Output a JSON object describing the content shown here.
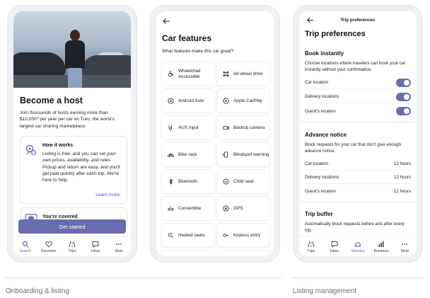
{
  "colors": {
    "accent": "#6b6bb0",
    "link": "#593cfb"
  },
  "onboarding": {
    "title": "Become a host",
    "description": "Join thousands of hosts earning more than $10,000* per year per car on Turo, the world's largest car sharing marketplace.",
    "how_it_works": {
      "icon": "gears-icon",
      "title": "How it works",
      "description": "Listing is free, and you can set your own prices, availability, and rules. Pickup and return are easy, and you'll get paid quickly after each trip. We're here to help.",
      "link": "Learn more"
    },
    "covered": {
      "icon": "shield-card-icon",
      "title": "You're covered"
    },
    "cta": "Get started",
    "tabs": [
      {
        "label": "Search",
        "icon": "search-icon",
        "active": true
      },
      {
        "label": "Favorites",
        "icon": "heart-icon",
        "active": false
      },
      {
        "label": "Trips",
        "icon": "road-icon",
        "active": false
      },
      {
        "label": "Inbox",
        "icon": "chat-icon",
        "active": false
      },
      {
        "label": "More",
        "icon": "more-icon",
        "active": false
      }
    ]
  },
  "car_features": {
    "title": "Car features",
    "subtitle": "What features make this car great?",
    "features": [
      {
        "label": "Wheelchair Accessible",
        "icon": "wheelchair-icon"
      },
      {
        "label": "All-wheel drive",
        "icon": "awd-icon"
      },
      {
        "label": "Android Auto",
        "icon": "android-auto-icon"
      },
      {
        "label": "Apple CarPlay",
        "icon": "carplay-icon"
      },
      {
        "label": "AUX input",
        "icon": "aux-icon"
      },
      {
        "label": "Backup camera",
        "icon": "camera-icon"
      },
      {
        "label": "Bike rack",
        "icon": "bike-icon"
      },
      {
        "label": "Blindspot warning",
        "icon": "blindspot-icon"
      },
      {
        "label": "Bluetooth",
        "icon": "bluetooth-icon"
      },
      {
        "label": "Child seat",
        "icon": "child-seat-icon"
      },
      {
        "label": "Convertible",
        "icon": "convertible-icon"
      },
      {
        "label": "GPS",
        "icon": "gps-icon"
      },
      {
        "label": "Heated seats",
        "icon": "heated-seat-icon"
      },
      {
        "label": "Keyless entry",
        "icon": "key-icon"
      }
    ]
  },
  "trip_preferences": {
    "header": "Trip preferences",
    "title": "Trip preferences",
    "book_instantly": {
      "title": "Book instantly",
      "description": "Choose locations where travelers can book your car instantly without your confirmation.",
      "rows": [
        {
          "label": "Car location",
          "on": true
        },
        {
          "label": "Delivery locations",
          "on": true
        },
        {
          "label": "Guest's location",
          "on": true
        }
      ]
    },
    "advance_notice": {
      "title": "Advance notice",
      "description": "Block requests for your car that don't give enough advance notice.",
      "rows": [
        {
          "label": "Car location",
          "value": "12 hours"
        },
        {
          "label": "Delivery locations",
          "value": "12 hours"
        },
        {
          "label": "Guest's location",
          "value": "12 hours"
        }
      ]
    },
    "trip_buffer": {
      "title": "Trip buffer",
      "description": "Automatically block requests before and after every trip."
    },
    "tabs": [
      {
        "label": "Trips",
        "icon": "road-icon",
        "active": false
      },
      {
        "label": "Inbox",
        "icon": "chat-icon",
        "active": false
      },
      {
        "label": "Vehicles",
        "icon": "car-icon",
        "active": true
      },
      {
        "label": "Business",
        "icon": "bar-chart-icon",
        "active": false
      },
      {
        "label": "More",
        "icon": "more-icon",
        "active": false
      }
    ]
  },
  "captions": {
    "left": "Onboarding & listing",
    "right": "Listing management"
  }
}
